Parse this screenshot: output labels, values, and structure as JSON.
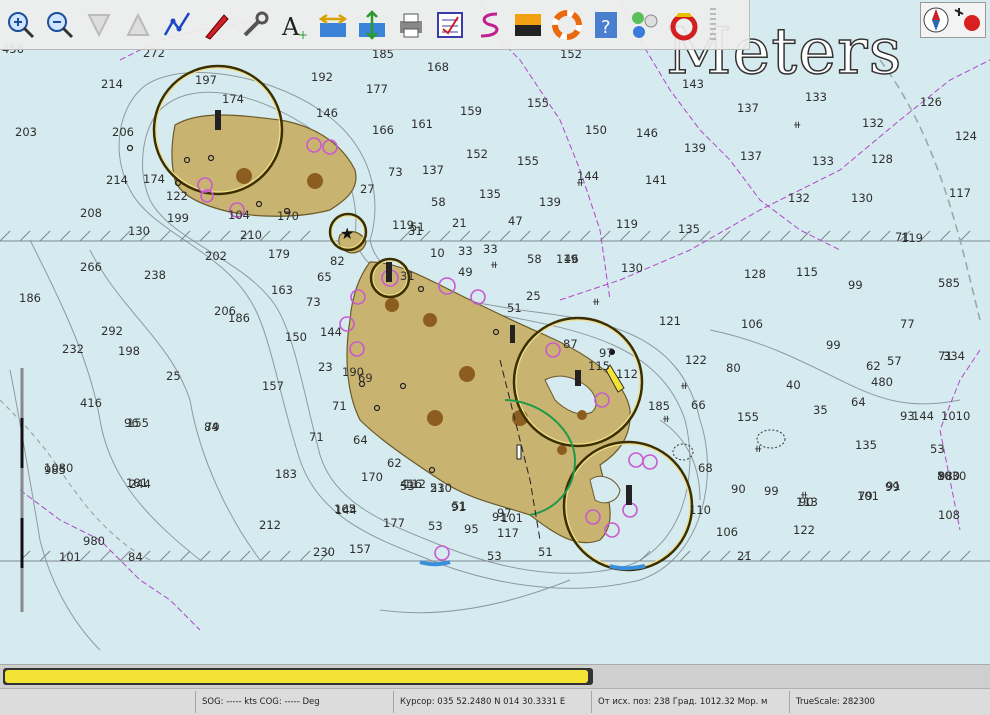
{
  "toolbar": {
    "buttons": [
      {
        "icon": "zoom-in-icon",
        "tooltip": ""
      },
      {
        "icon": "zoom-out-icon",
        "tooltip": ""
      },
      {
        "icon": "scale-in-icon",
        "tooltip": ""
      },
      {
        "icon": "scale-out-icon",
        "tooltip": ""
      },
      {
        "icon": "route-icon",
        "tooltip": ""
      },
      {
        "icon": "follow-ship-icon",
        "tooltip": ""
      },
      {
        "icon": "settings-wrench-icon",
        "tooltip": ""
      },
      {
        "icon": "text-icon",
        "tooltip": ""
      },
      {
        "icon": "current-icon",
        "tooltip": ""
      },
      {
        "icon": "tide-icon",
        "tooltip": ""
      },
      {
        "icon": "print-icon",
        "tooltip": ""
      },
      {
        "icon": "route-manager-icon",
        "tooltip": ""
      },
      {
        "icon": "track-icon",
        "tooltip": ""
      },
      {
        "icon": "color-scheme-icon",
        "tooltip": ""
      },
      {
        "icon": "mob-lifebuoy-icon",
        "tooltip": ""
      },
      {
        "icon": "help-icon",
        "tooltip": ""
      },
      {
        "icon": "ais-icon",
        "tooltip": ""
      },
      {
        "icon": "mob-alert-icon",
        "tooltip": ""
      }
    ]
  },
  "chart": {
    "units_label": "Meters",
    "colors": {
      "sea": "#d6ebef",
      "land": "#c9b370",
      "land_edge": "#6b5a2a",
      "depth_contour": "#8a9aa0",
      "boundary": "#b146c8",
      "range_ring": "#3b2f00",
      "arc_green": "#1f9a4a"
    },
    "soundings": [
      "456",
      "272",
      "185",
      "168",
      "152",
      "214",
      "197",
      "192",
      "177",
      "203",
      "206",
      "174",
      "146",
      "166",
      "161",
      "159",
      "155",
      "150",
      "146",
      "135",
      "143",
      "137",
      "133",
      "132",
      "126",
      "124",
      "139",
      "137",
      "133",
      "128",
      "117",
      "208",
      "214",
      "174",
      "122",
      "73",
      "152",
      "137",
      "155",
      "144",
      "141",
      "199",
      "104",
      "139",
      "135",
      "132",
      "130",
      "27",
      "58",
      "51",
      "21",
      "47",
      "71",
      "130",
      "210",
      "170",
      "119",
      "31",
      "10",
      "33",
      "46",
      "119",
      "119",
      "266",
      "238",
      "202",
      "179",
      "82",
      "65",
      "33",
      "49",
      "58",
      "119",
      "130",
      "128",
      "115",
      "99",
      "585",
      "186",
      "163",
      "73",
      "31",
      "51",
      "25",
      "121",
      "106",
      "77",
      "206",
      "144",
      "97",
      "87",
      "122",
      "99",
      "71",
      "62",
      "57",
      "334",
      "292",
      "198",
      "186",
      "150",
      "23",
      "69",
      "115",
      "80",
      "40",
      "480",
      "232",
      "25",
      "190",
      "157",
      "71",
      "112",
      "66",
      "35",
      "64",
      "93",
      "1010",
      "416",
      "155",
      "79",
      "71",
      "64",
      "62",
      "416",
      "210",
      "185",
      "155",
      "135",
      "144",
      "53",
      "96",
      "84",
      "1080",
      "183",
      "170",
      "53",
      "68",
      "90",
      "99",
      "80",
      "985",
      "181",
      "144",
      "53",
      "91",
      "97",
      "90",
      "79",
      "91",
      "980",
      "244",
      "165",
      "112",
      "51",
      "101",
      "113",
      "101",
      "99",
      "1030",
      "980",
      "212",
      "177",
      "53",
      "91",
      "110",
      "106",
      "122",
      "108",
      "101",
      "84",
      "230",
      "157",
      "95",
      "117",
      "53",
      "51",
      "21"
    ],
    "star_symbol": "★"
  },
  "progress": {
    "fraction": 0.995
  },
  "status": {
    "sog_cog": "SOG: ----- kts  COG: ----- Deg",
    "cursor": "Курсор: 035 52.2480 N 014 30.3331 E",
    "from_own": "От исх. поз: 238 Град.  1012.32 Мор. м",
    "true_scale": "TrueScale:    282300"
  }
}
